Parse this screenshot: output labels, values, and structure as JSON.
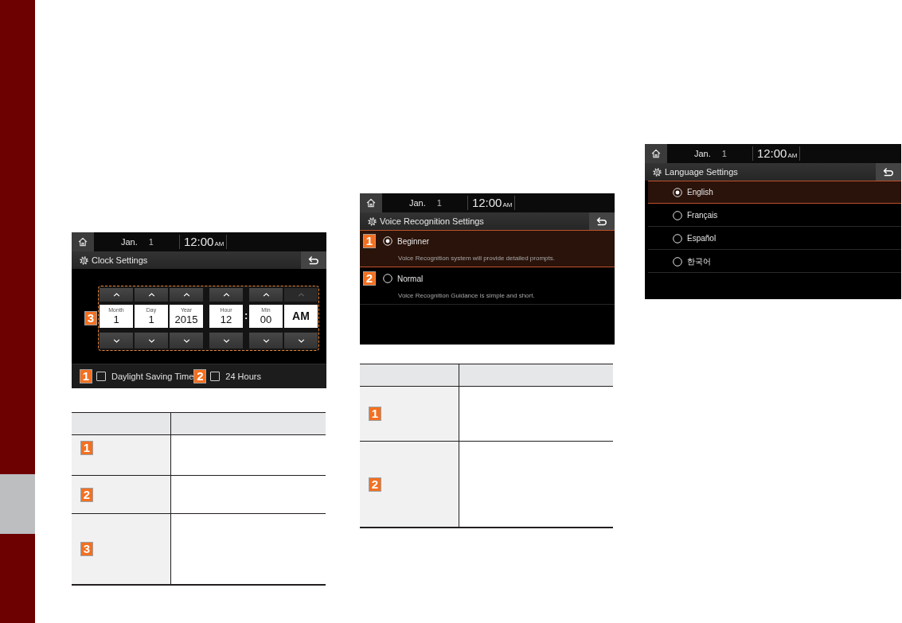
{
  "clock_screen": {
    "status_bar": {
      "month": "Jan.",
      "day": "1",
      "time": "12:00",
      "meridiem": "AM"
    },
    "title": "Clock Settings",
    "picker": {
      "callout": "3",
      "groups": [
        {
          "fields": [
            {
              "kind": "spinner",
              "label": "Month",
              "value": "1",
              "up_disabled": false,
              "down_disabled": false
            },
            {
              "kind": "spinner",
              "label": "Day",
              "value": "1",
              "up_disabled": false,
              "down_disabled": false
            },
            {
              "kind": "spinner",
              "label": "Year",
              "value": "2015",
              "up_disabled": false,
              "down_disabled": false
            }
          ]
        },
        {
          "fields": [
            {
              "kind": "spinner",
              "label": "Hour",
              "value": "12",
              "up_disabled": false,
              "down_disabled": false
            },
            {
              "kind": "separator",
              "text": ":"
            },
            {
              "kind": "spinner",
              "label": "Min",
              "value": "00",
              "up_disabled": false,
              "down_disabled": false
            },
            {
              "kind": "toggle",
              "value": "AM",
              "up_disabled": true,
              "down_disabled": false
            }
          ]
        }
      ]
    },
    "options": [
      {
        "callout": "1",
        "label": "Daylight Saving Time",
        "checked": false
      },
      {
        "callout": "2",
        "label": "24 Hours",
        "checked": false
      }
    ]
  },
  "clock_table": {
    "rows": [
      {
        "callout": "1"
      },
      {
        "callout": "2"
      },
      {
        "callout": "3"
      }
    ]
  },
  "voice_screen": {
    "status_bar": {
      "month": "Jan.",
      "day": "1",
      "time": "12:00",
      "meridiem": "AM"
    },
    "title": "Voice Recognition Settings",
    "items": [
      {
        "callout": "1",
        "label": "Beginner",
        "description": "Voice Recognition system will provide detailed prompts.",
        "selected": true
      },
      {
        "callout": "2",
        "label": "Normal",
        "description": "Voice Recognition Guidance is simple and short.",
        "selected": false
      }
    ]
  },
  "voice_table": {
    "rows": [
      {
        "callout": "1"
      },
      {
        "callout": "2"
      }
    ]
  },
  "language_screen": {
    "status_bar": {
      "month": "Jan.",
      "day": "1",
      "time": "12:00",
      "meridiem": "AM"
    },
    "title": "Language Settings",
    "items": [
      {
        "label": "English",
        "selected": true
      },
      {
        "label": "Français",
        "selected": false
      },
      {
        "label": "Español",
        "selected": false
      },
      {
        "label": "한국어",
        "selected": false
      }
    ]
  }
}
